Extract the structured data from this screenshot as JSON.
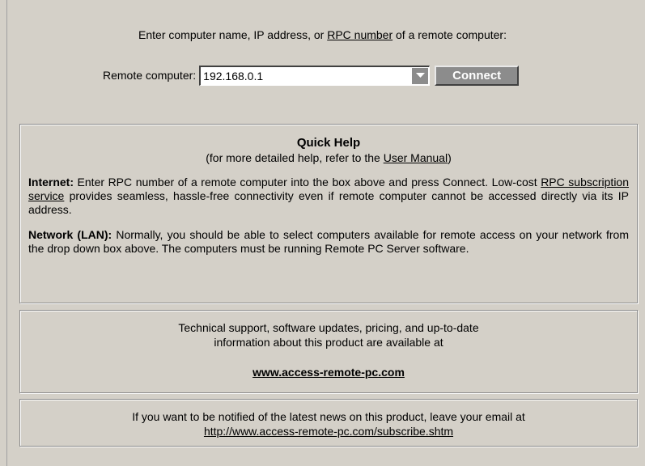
{
  "prompt": {
    "before": "Enter computer name, IP address, or ",
    "link": "RPC number",
    "after": " of a remote computer:"
  },
  "remote": {
    "label": "Remote computer:",
    "value": "192.168.0.1",
    "dropdown_icon": "chevron-down-icon",
    "connect_label": "Connect"
  },
  "help": {
    "title": "Quick Help",
    "subtitle_before": "(for more detailed help, refer to the ",
    "subtitle_link": "User Manual",
    "subtitle_after": ")",
    "internet_label": "Internet:",
    "internet_text1": " Enter RPC number of a remote computer into the box above and press Connect. Low-cost ",
    "internet_link": "RPC subscription service",
    "internet_text2": " provides seamless, hassle-free connectivity even if remote computer cannot be accessed directly via its IP address.",
    "network_label": "Network (LAN):",
    "network_text": " Normally, you should be able to select computers available for remote access on your network from the drop down box above. The computers must be running Remote PC Server software."
  },
  "support": {
    "line1": "Technical support, software updates, pricing, and up-to-date",
    "line2": "information about this product are available at",
    "url": "www.access-remote-pc.com"
  },
  "subscribe": {
    "line1": "If you want to be notified of the latest news on this product, leave your email at",
    "url": "http://www.access-remote-pc.com/subscribe.shtm"
  },
  "colors": {
    "background": "#d4d0c8",
    "button": "#8c8c8c",
    "button_text": "#ffffff"
  }
}
